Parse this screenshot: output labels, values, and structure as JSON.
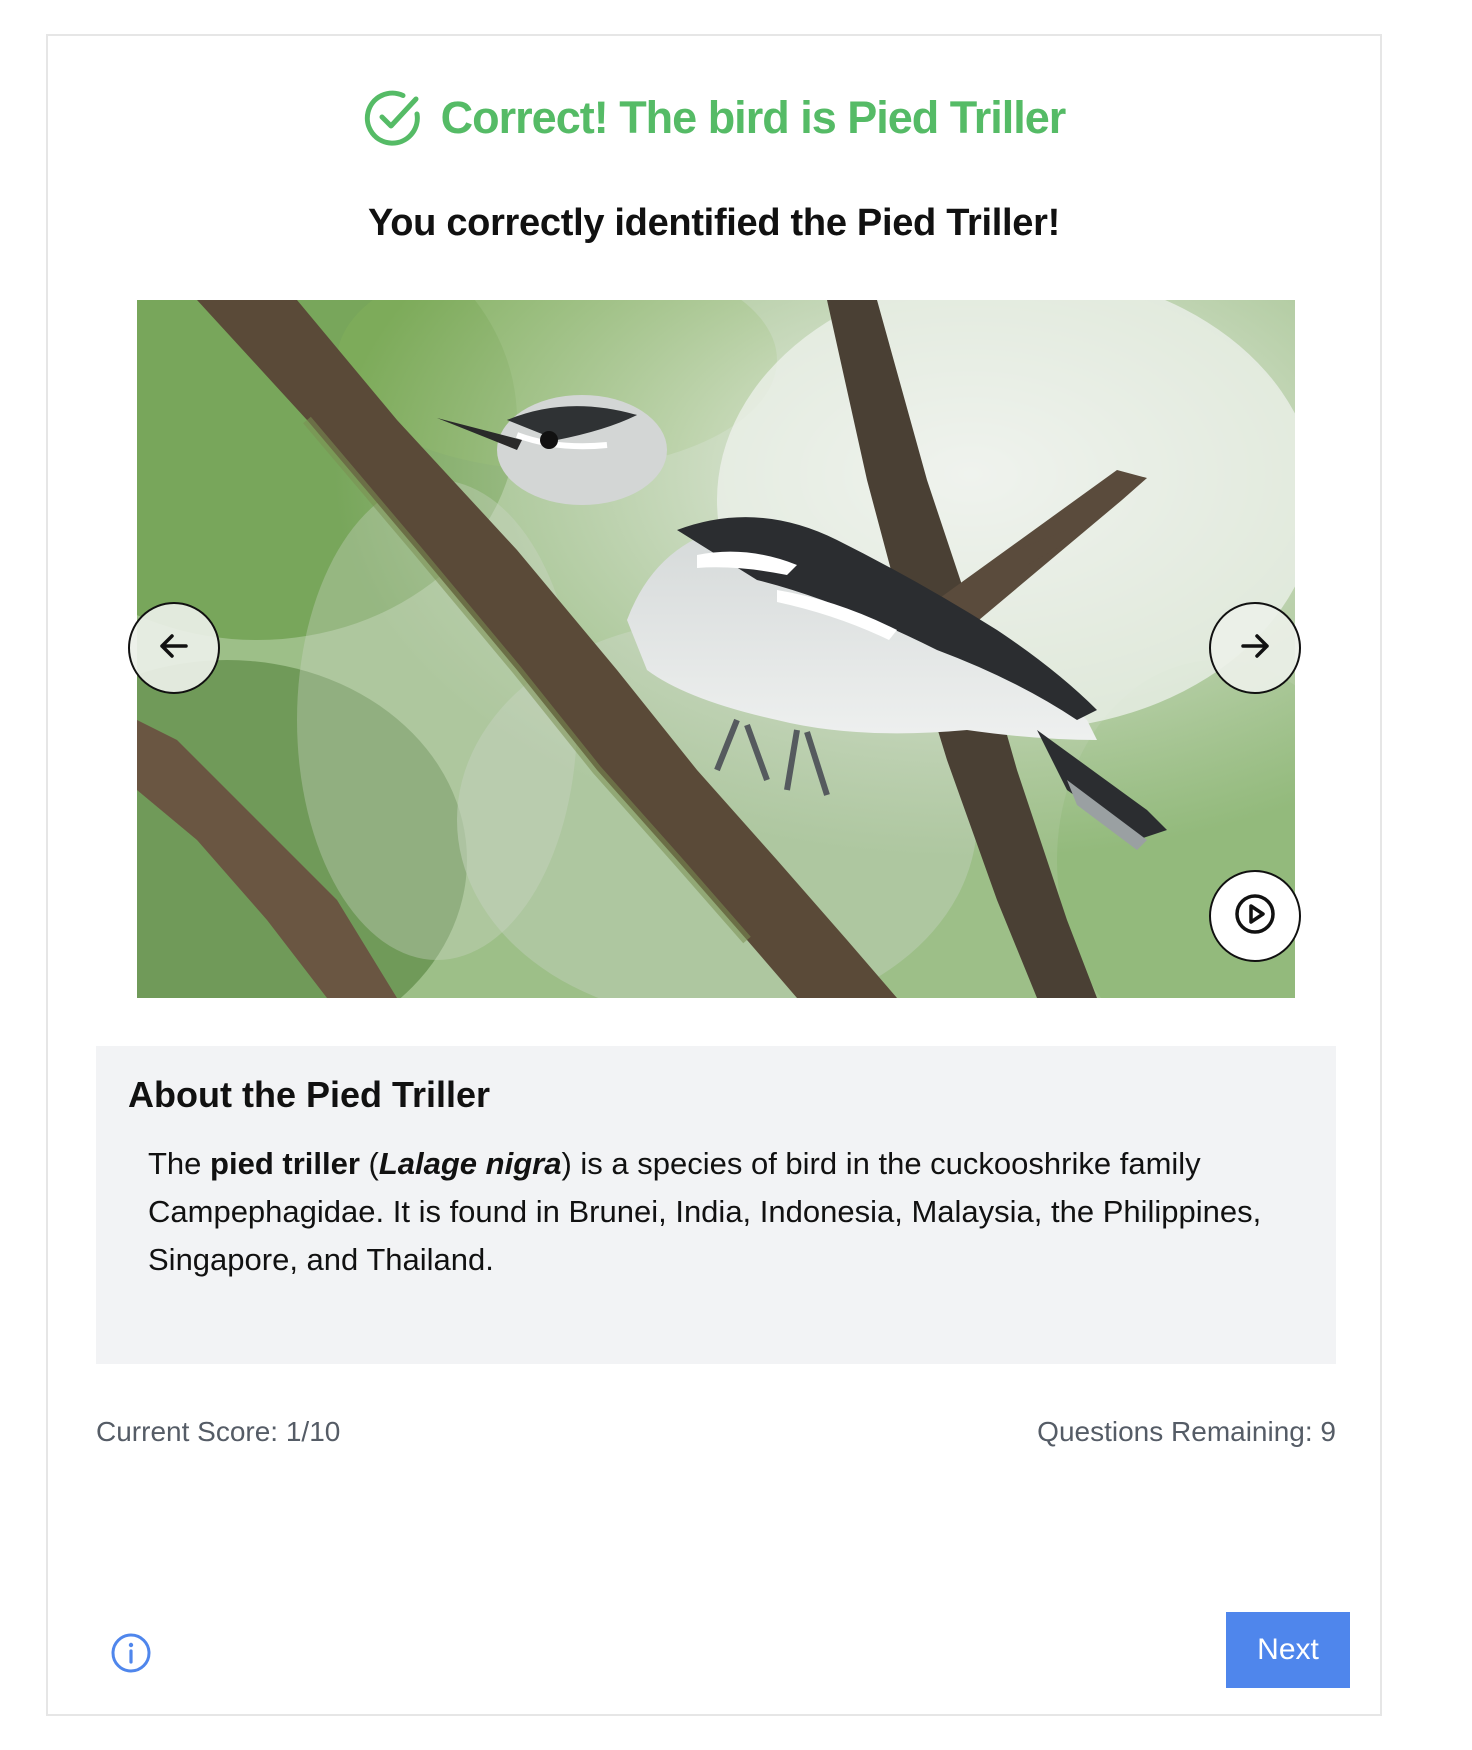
{
  "result": {
    "title": "Correct! The bird is Pied Triller",
    "subtitle": "You correctly identified the Pied Triller!",
    "icon": "check-circle-icon",
    "color": "#55bb66"
  },
  "gallery": {
    "prev_icon": "arrow-left-icon",
    "next_icon": "arrow-right-icon",
    "play_icon": "play-circle-icon"
  },
  "about": {
    "heading": "About the Pied Triller",
    "common_name": "pied triller",
    "scientific_name": "Lalage nigra",
    "text_before": "The ",
    "text_open_paren": " (",
    "text_after": ") is a species of bird in the cuckooshrike family Campephagidae. It is found in Brunei, India, Indonesia, Malaysia, the Philippines, Singapore, and Thailand."
  },
  "status": {
    "score": "Current Score: 1/10",
    "remaining": "Questions Remaining: 9"
  },
  "footer": {
    "info_icon": "info-icon",
    "next_label": "Next",
    "accent": "#4f86ec"
  }
}
